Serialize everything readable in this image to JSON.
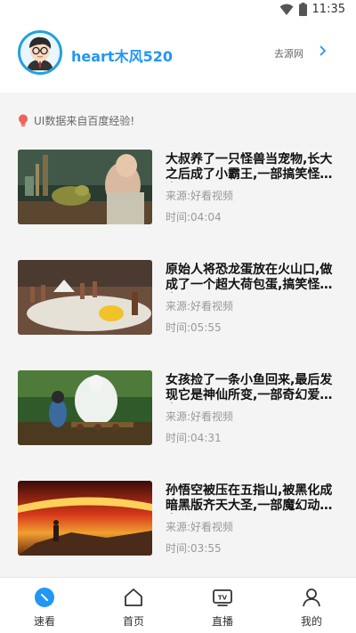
{
  "status_bar": {
    "time": "11:35"
  },
  "profile": {
    "username": "heart木风520",
    "goto_label": "去源网"
  },
  "hint": {
    "text": "UI数据来自百度经验!"
  },
  "videos": [
    {
      "title": "大叔养了一只怪兽当宠物,长大之后成了小霸王,一部搞笑怪兽电影",
      "source_label": "来源:",
      "source": "好看视频",
      "time_label": "时间:",
      "duration": "04:04"
    },
    {
      "title": "原始人将恐龙蛋放在火山口,做成了一个超大荷包蛋,搞笑怪兽电影",
      "source_label": "来源:",
      "source": "好看视频",
      "time_label": "时间:",
      "duration": "05:55"
    },
    {
      "title": "女孩捡了一条小鱼回来,最后发现它是神仙所变,一部奇幻爱情电影",
      "source_label": "来源:",
      "source": "好看视频",
      "time_label": "时间:",
      "duration": "04:31"
    },
    {
      "title": "孙悟空被压在五指山,被黑化成暗黑版齐天大圣,一部魔幻动作电影",
      "source_label": "来源:",
      "source": "好看视频",
      "time_label": "时间:",
      "duration": "03:55"
    }
  ],
  "tabs": [
    {
      "label": "速看",
      "icon": "quick-view-icon",
      "active": true
    },
    {
      "label": "首页",
      "icon": "home-icon",
      "active": false
    },
    {
      "label": "直播",
      "icon": "tv-icon",
      "active": false
    },
    {
      "label": "我的",
      "icon": "person-icon",
      "active": false
    }
  ],
  "colors": {
    "accent": "#2196f3",
    "avatar_ring": "#22a0e0",
    "hint_bulb": "#f0625a"
  }
}
